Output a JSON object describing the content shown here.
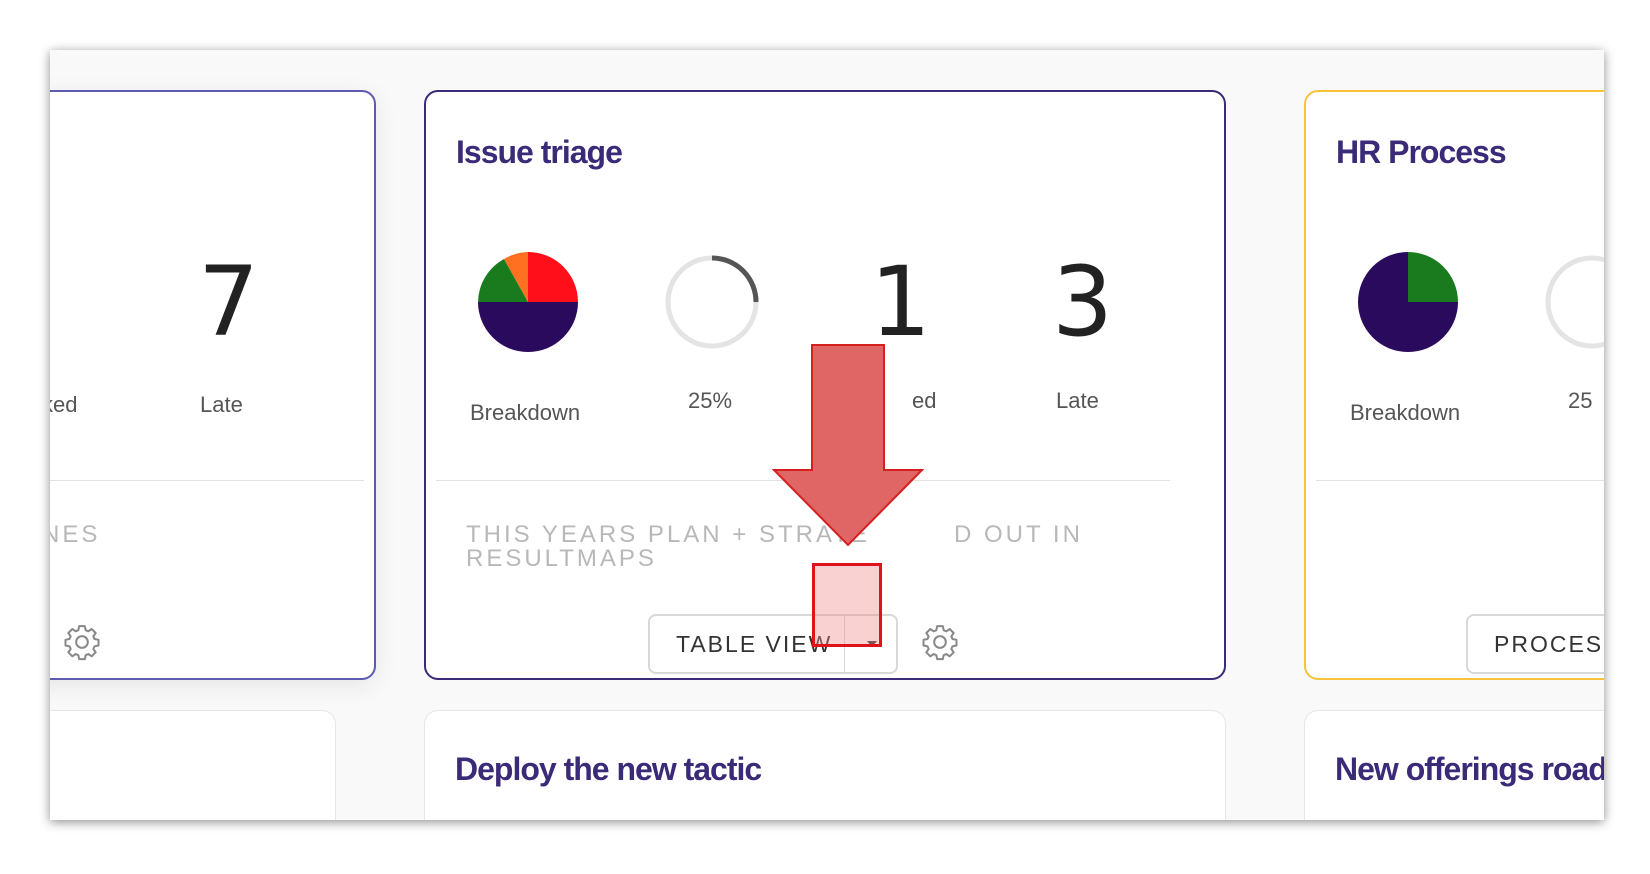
{
  "left_card": {
    "value_late": "7",
    "label_partial": "ked",
    "label_late": "Late",
    "desc_partial": "NES"
  },
  "issue_card": {
    "title": "Issue triage",
    "breakdown_label": "Breakdown",
    "progress_label": "25%",
    "progress_value": 0.25,
    "value_blocked": "1",
    "label_blocked_partial": "ed",
    "value_late": "3",
    "label_late": "Late",
    "desc_line1": "THIS YEARS PLAN + STRATE",
    "desc_line1_end": "D OUT IN",
    "desc_line2": "RESULTMAPS",
    "view_button": "TABLE VIEW",
    "pie_colors": [
      "#ff0f1a",
      "#2a0a5c",
      "#1a7a1e",
      "#ff7020"
    ]
  },
  "hr_card": {
    "title": "HR Process",
    "breakdown_label": "Breakdown",
    "progress_label_partial": "25",
    "view_button_partial": "PROCES",
    "pie_colors": [
      "#2a0a5c",
      "#1a7a1e"
    ]
  },
  "bottom_cards": {
    "middle_title": "Deploy the new tactic",
    "right_title": "New offerings road"
  },
  "accent_colors": {
    "left_border": "#5d5ab0",
    "issue_border": "#3a2a78",
    "hr_border": "#f6c33b",
    "annotation_arrow": "#e06666",
    "annotation_box": "#e0131c"
  }
}
